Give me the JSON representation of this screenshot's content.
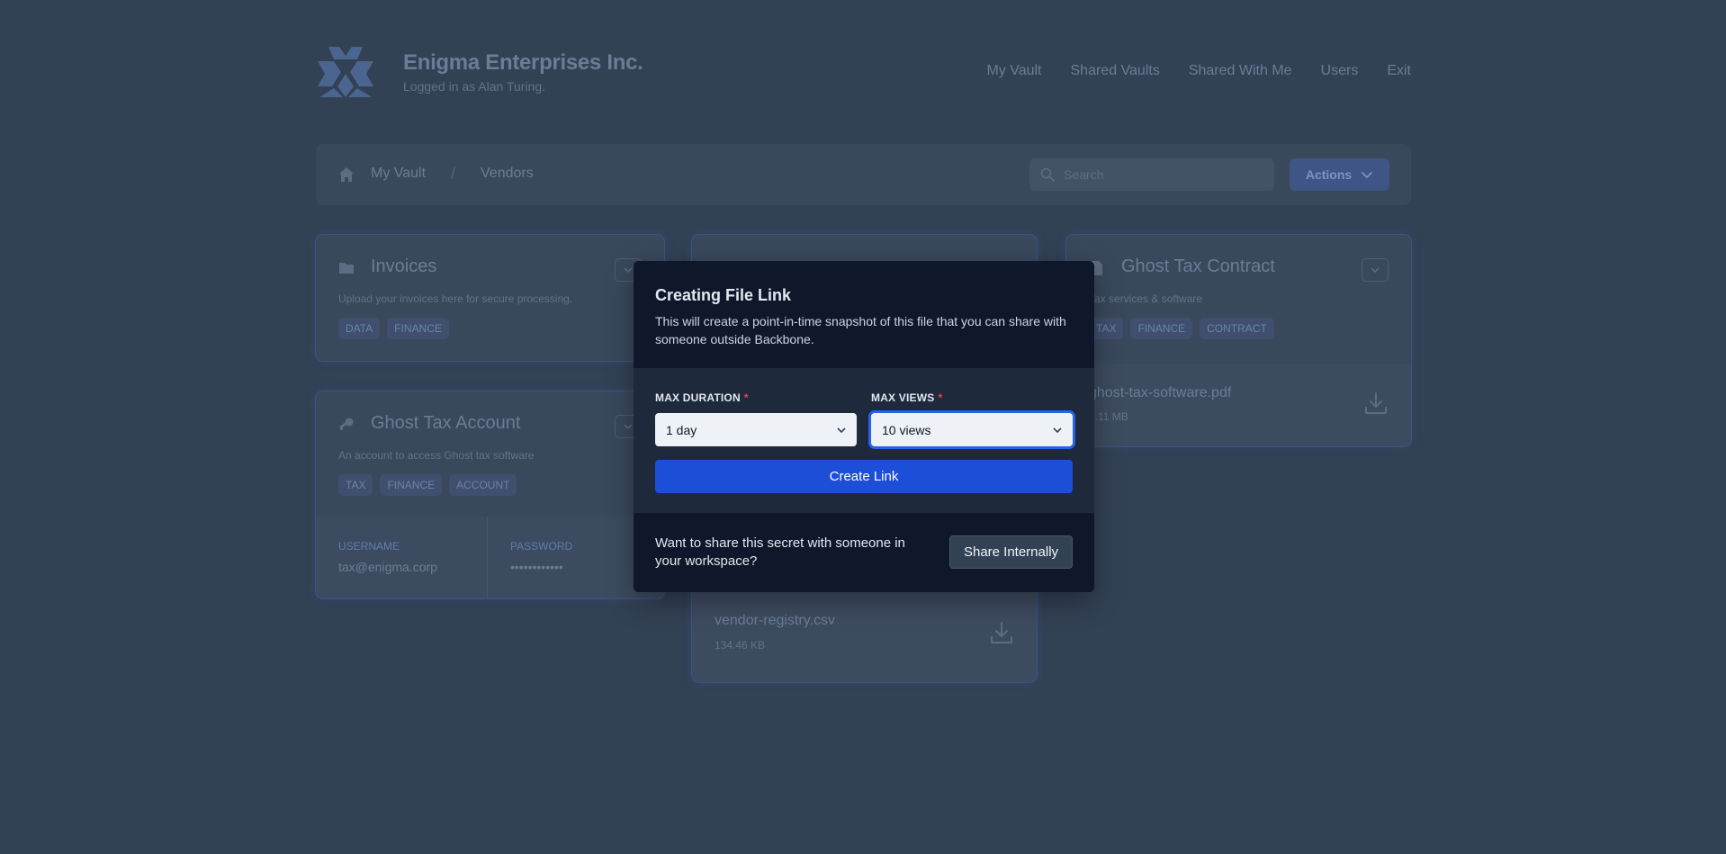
{
  "header": {
    "company_name": "Enigma Enterprises Inc.",
    "logged_in": "Logged in as Alan Turing.",
    "nav": [
      "My Vault",
      "Shared Vaults",
      "Shared With Me",
      "Users",
      "Exit"
    ]
  },
  "toolbar": {
    "breadcrumb": [
      "My Vault",
      "Vendors"
    ],
    "separator": "/",
    "search_placeholder": "Search",
    "actions_label": "Actions"
  },
  "cards": {
    "invoices": {
      "icon": "folder-icon",
      "title": "Invoices",
      "description": "Upload your invoices here for secure processing.",
      "tags": [
        "DATA",
        "FINANCE"
      ]
    },
    "ghost_tax_account": {
      "icon": "key-icon",
      "title": "Ghost Tax Account",
      "description": "An account to access Ghost tax software",
      "tags": [
        "TAX",
        "FINANCE",
        "ACCOUNT"
      ],
      "username_label": "USERNAME",
      "username": "tax@enigma.corp",
      "password_label": "PASSWORD",
      "password": "••••••••••••"
    },
    "ghost_tax_contract": {
      "icon": "document-icon",
      "title": "Ghost Tax Contract",
      "description": "Tax services & software",
      "tags": [
        "TAX",
        "FINANCE",
        "CONTRACT"
      ],
      "file_name": "ghost-tax-software.pdf",
      "file_size": "2.11 MB"
    },
    "vendor_registry": {
      "file_name": "vendor-registry.csv",
      "file_size": "134.46 KB"
    }
  },
  "modal": {
    "title": "Creating File Link",
    "description": "This will create a point-in-time snapshot of this file that you can share with someone outside Backbone.",
    "max_duration_label": "MAX DURATION",
    "max_duration_value": "1 day",
    "max_views_label": "MAX VIEWS",
    "max_views_value": "10 views",
    "required_mark": "*",
    "create_label": "Create Link",
    "share_text": "Want to share this secret with someone in your workspace?",
    "share_label": "Share Internally"
  },
  "colors": {
    "background": "#334155",
    "modal_bg": "#1e293b",
    "modal_header_bg": "#0f172a",
    "primary": "#1d4ed8",
    "required": "#ef4444"
  }
}
